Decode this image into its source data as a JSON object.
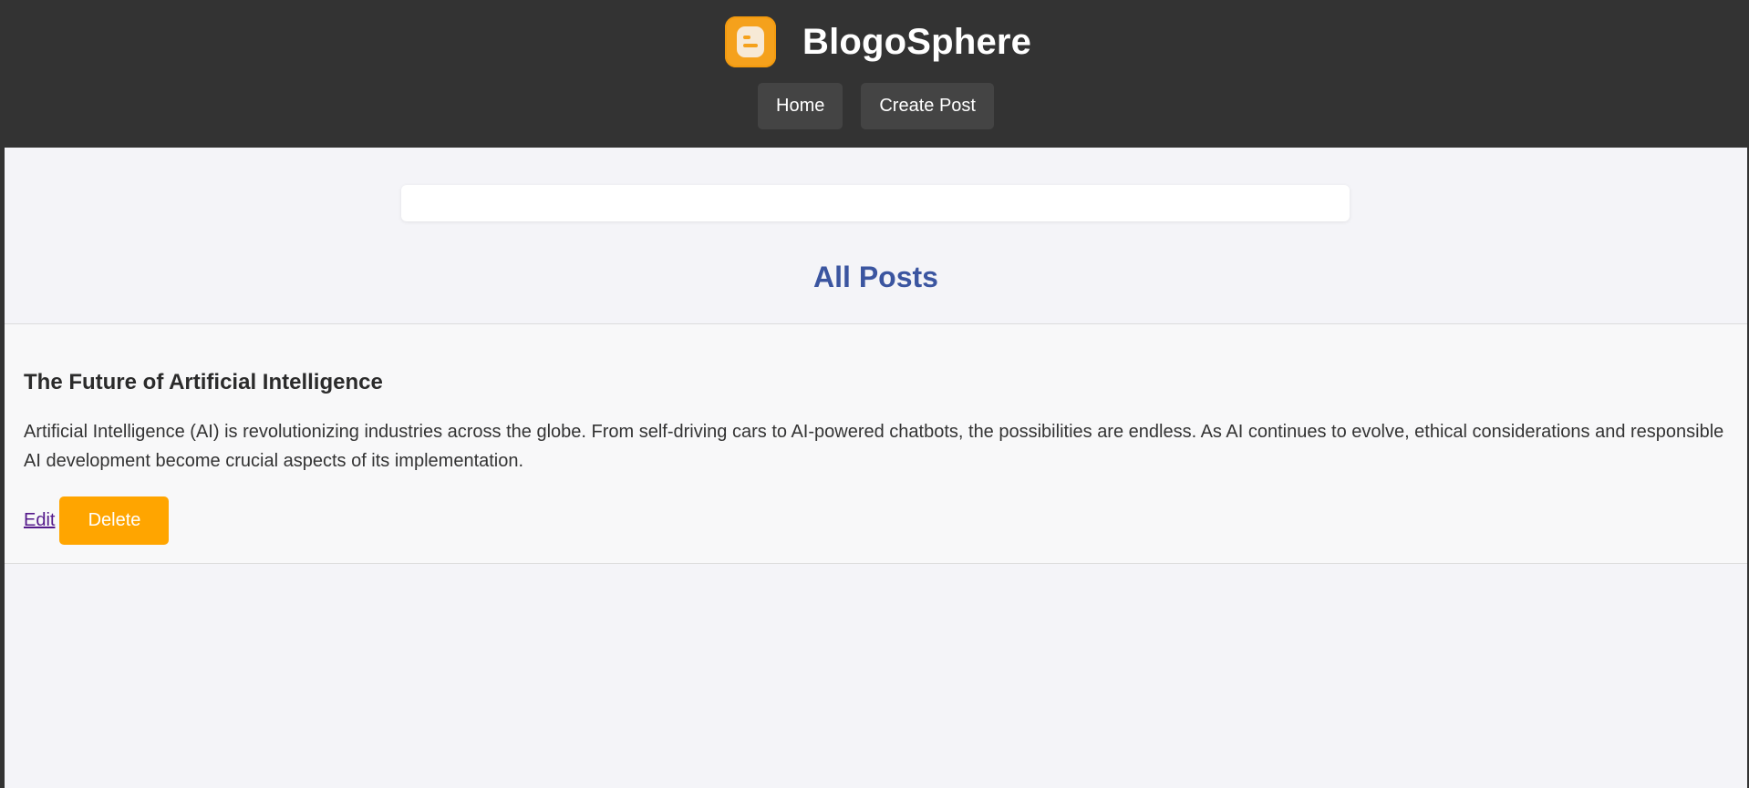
{
  "header": {
    "site_title": "BlogoSphere",
    "nav": {
      "home_label": "Home",
      "create_post_label": "Create Post"
    }
  },
  "search": {
    "value": "",
    "placeholder": ""
  },
  "main": {
    "section_title": "All Posts",
    "posts": [
      {
        "title": "The Future of Artificial Intelligence",
        "body": "Artificial Intelligence (AI) is revolutionizing industries across the globe. From self-driving cars to AI-powered chatbots, the possibilities are endless. As AI continues to evolve, ethical considerations and responsible AI development become crucial aspects of its implementation.",
        "edit_label": "Edit",
        "delete_label": "Delete"
      }
    ]
  },
  "icons": {
    "logo": "blogger-logo-icon"
  },
  "colors": {
    "header_bg": "#333333",
    "nav_button_bg": "#444444",
    "accent": "#ffa500",
    "section_title": "#3b55a0",
    "logo": "#f5a11c",
    "link": "#551a8b"
  }
}
